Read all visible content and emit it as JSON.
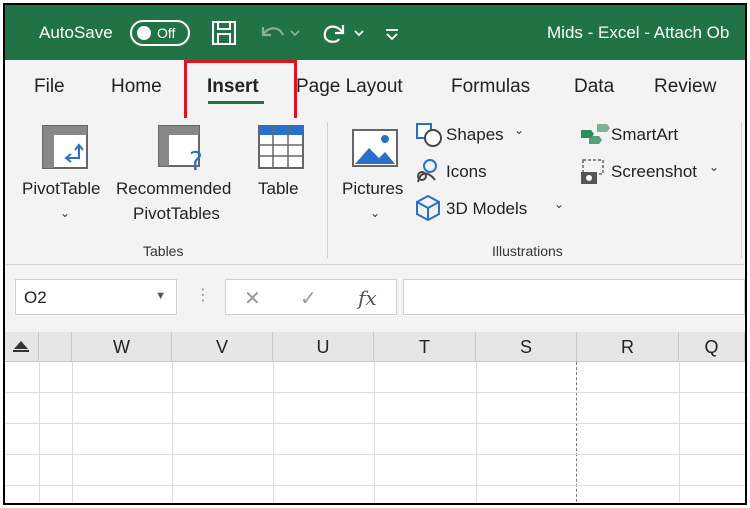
{
  "titlebar": {
    "autosave_label": "AutoSave",
    "autosave_state": "Off",
    "document_title": "Mids - Excel - Attach Ob"
  },
  "tabs": [
    {
      "label": "File"
    },
    {
      "label": "Home"
    },
    {
      "label": "Insert",
      "active": true
    },
    {
      "label": "Page Layout"
    },
    {
      "label": "Formulas"
    },
    {
      "label": "Data"
    },
    {
      "label": "Review"
    }
  ],
  "ribbon": {
    "tables_group": {
      "label": "Tables",
      "pivottable": "PivotTable",
      "recommended_line1": "Recommended",
      "recommended_line2": "PivotTables",
      "table": "Table"
    },
    "illustrations_group": {
      "label": "Illustrations",
      "pictures": "Pictures",
      "shapes": "Shapes",
      "icons": "Icons",
      "models": "3D Models",
      "smartart": "SmartArt",
      "screenshot": "Screenshot"
    }
  },
  "formula_bar": {
    "name_box": "O2",
    "formula": ""
  },
  "grid": {
    "columns": [
      "W",
      "V",
      "U",
      "T",
      "S",
      "R",
      "Q"
    ]
  },
  "colors": {
    "excel_green": "#217346",
    "highlight_red": "#e0141e",
    "ribbon_bg": "#f3f3f3"
  }
}
